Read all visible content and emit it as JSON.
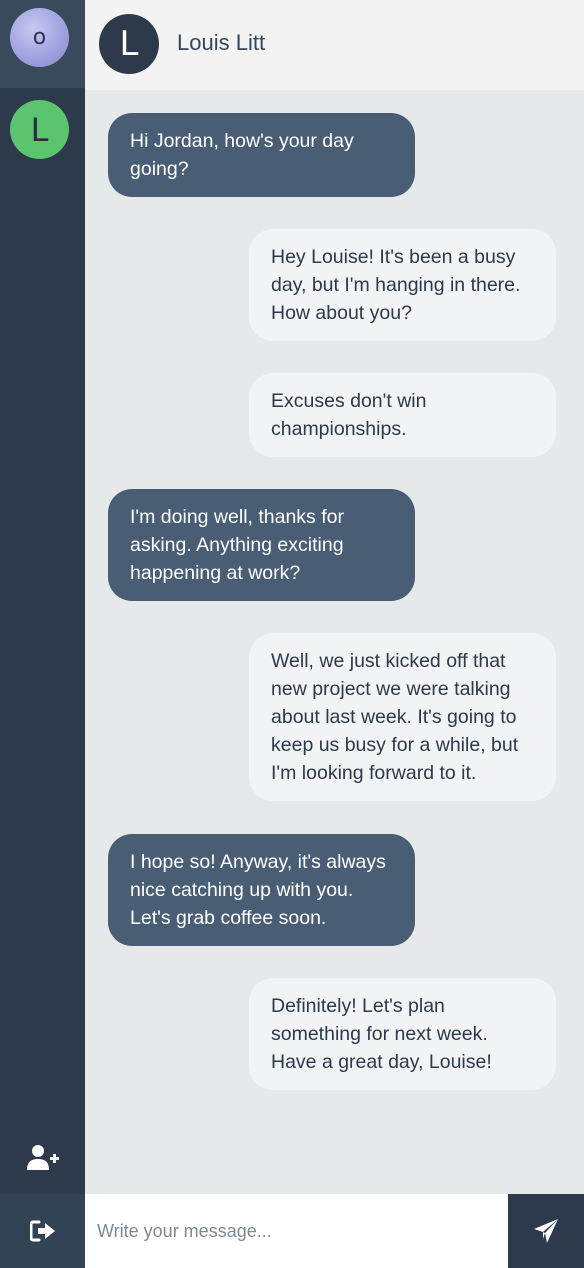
{
  "sidebar": {
    "contacts": [
      {
        "initial": "o",
        "active": true
      },
      {
        "initial": "L",
        "active": false
      }
    ],
    "add_contact_icon": "user-plus-icon",
    "logout_icon": "sign-out-icon"
  },
  "chat": {
    "contact_initial": "L",
    "contact_name": "Louis Litt",
    "messages": [
      {
        "direction": "incoming",
        "text": "Hi Jordan, how's your day going?"
      },
      {
        "direction": "outgoing",
        "text": "Hey Louise! It's been a busy day, but I'm hanging in there. How about you?"
      },
      {
        "direction": "outgoing",
        "text": "Excuses don't win championships."
      },
      {
        "direction": "incoming",
        "text": "I'm doing well, thanks for asking. Anything exciting happening at work?"
      },
      {
        "direction": "outgoing",
        "text": "Well, we just kicked off that new project we were talking about last week. It's going to keep us busy for a while, but I'm looking forward to it."
      },
      {
        "direction": "incoming",
        "text": "I hope so! Anyway, it's always nice catching up with you. Let's grab coffee soon."
      },
      {
        "direction": "outgoing",
        "text": "Definitely! Let's plan something for next week. Have a great day, Louise!"
      }
    ]
  },
  "composer": {
    "placeholder": "Write your message...",
    "value": "",
    "send_icon": "paper-plane-icon"
  },
  "colors": {
    "sidebar": "#2d3a4b",
    "incoming_bubble": "#495d75",
    "outgoing_bubble": "#f2f3f4",
    "chat_background": "#e5e9ea",
    "online_avatar": "#5ac46f"
  }
}
